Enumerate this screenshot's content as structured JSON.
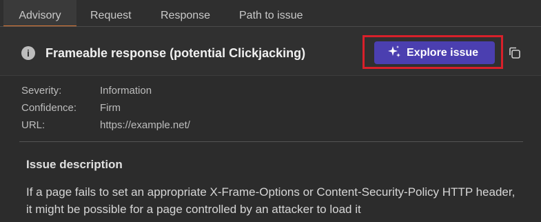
{
  "tabs": [
    {
      "label": "Advisory",
      "active": true
    },
    {
      "label": "Request",
      "active": false
    },
    {
      "label": "Response",
      "active": false
    },
    {
      "label": "Path to issue",
      "active": false
    }
  ],
  "issue": {
    "icon": "info-icon",
    "title": "Frameable response (potential Clickjacking)"
  },
  "actions": {
    "explore_label": "Explore issue",
    "explore_icon": "sparkle-icon",
    "copy_icon": "copy-icon"
  },
  "meta": {
    "severity_label": "Severity:",
    "severity_value": "Information",
    "confidence_label": "Confidence:",
    "confidence_value": "Firm",
    "url_label": "URL:",
    "url_value": "https://example.net/"
  },
  "description": {
    "heading": "Issue description",
    "text": "If a page fails to set an appropriate X-Frame-Options or Content-Security-Policy HTTP header, it might be possible for a page controlled by an attacker to load it"
  },
  "colors": {
    "accent_tab": "#e07b39",
    "button_bg": "#4b3fb0",
    "highlight": "#d9202a"
  }
}
